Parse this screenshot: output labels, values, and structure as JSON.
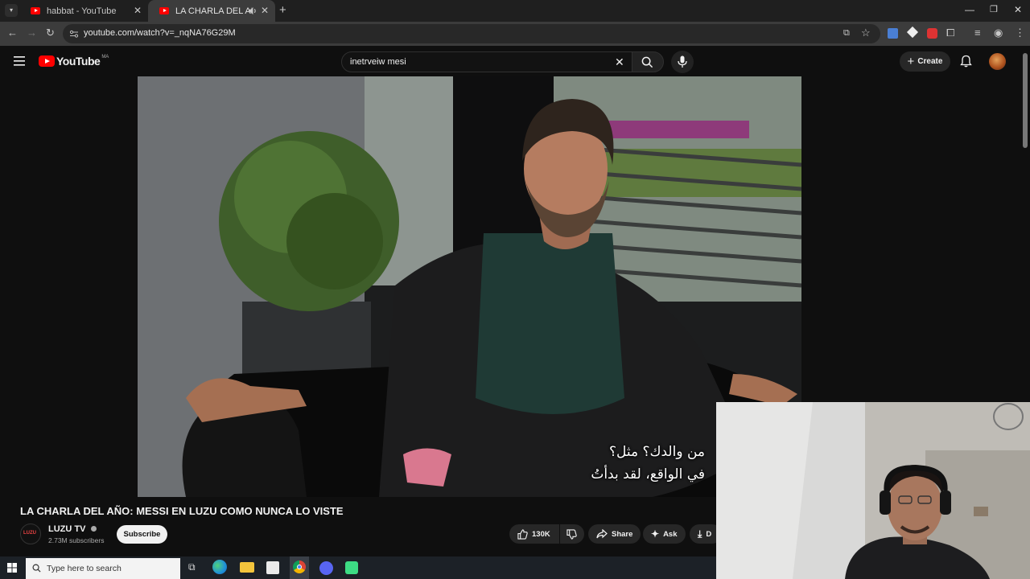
{
  "browser": {
    "tabs": [
      {
        "title": "habbat - YouTube",
        "active": false
      },
      {
        "title": "LA CHARLA DEL AÑO: MESSI",
        "active": true
      }
    ],
    "url": "youtube.com/watch?v=_nqNA76G29M"
  },
  "youtube": {
    "logo_text": "YouTube",
    "logo_region": "MA",
    "search_value": "inetrveiw mesi",
    "create_label": "Create",
    "subtitles": [
      "من والدك؟ مثل؟",
      "في الواقع، لقد بدأتُ"
    ],
    "video_title": "LA CHARLA DEL AÑO: MESSI EN LUZU COMO NUNCA LO VISTE",
    "channel": {
      "name": "LUZU TV",
      "avatar_text": "LUZU",
      "subscribers": "2.73M subscribers",
      "subscribe_label": "Subscribe"
    },
    "actions": {
      "likes": "130K",
      "share_label": "Share",
      "ask_label": "Ask",
      "download_label": "D"
    }
  },
  "taskbar": {
    "search_placeholder": "Type here to search"
  },
  "colors": {
    "youtube_red": "#ff0000",
    "page_bg": "#0f0f0f",
    "chrome_bg": "#1f1f1f"
  }
}
